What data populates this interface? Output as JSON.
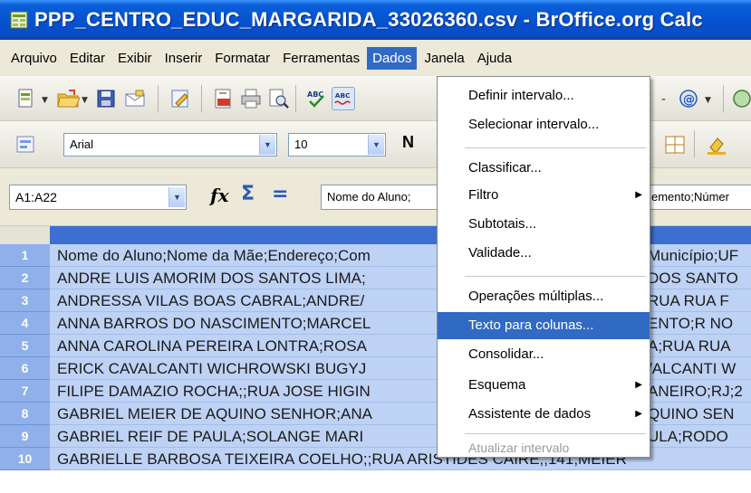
{
  "window": {
    "title": "PPP_CENTRO_EDUC_MARGARIDA_33026360.csv - BrOffice.org Calc"
  },
  "menubar": {
    "items": [
      "Arquivo",
      "Editar",
      "Exibir",
      "Inserir",
      "Formatar",
      "Ferramentas",
      "Dados",
      "Janela",
      "Ajuda"
    ],
    "active": "Dados"
  },
  "toolbar_formatting": {
    "font_name": "Arial",
    "font_size": "10",
    "bold_label": "N"
  },
  "formula_bar": {
    "name_box": "A1:A22",
    "content": "Nome do Aluno;",
    "content_right": "emento;Númer"
  },
  "sheet": {
    "rows": [
      {
        "num": "1",
        "text": "Nome do Aluno;Nome da Mãe;Endereço;Com",
        "right": "Município;UF"
      },
      {
        "num": "2",
        "text": "ANDRE LUIS AMORIM DOS SANTOS LIMA;",
        "right": "DOS SANTO"
      },
      {
        "num": "3",
        "text": "ANDRESSA VILAS BOAS CABRAL;ANDRE/",
        "right": "RUA RUA F"
      },
      {
        "num": "4",
        "text": "ANNA BARROS DO NASCIMENTO;MARCEL",
        "right": "ENTO;R NO"
      },
      {
        "num": "5",
        "text": "ANNA CAROLINA PEREIRA LONTRA;ROSA",
        "right": "A;RUA RUA"
      },
      {
        "num": "6",
        "text": "ERICK CAVALCANTI WICHROWSKI BUGYJ",
        "right": "/ALCANTI W"
      },
      {
        "num": "7",
        "text": "FILIPE DAMAZIO ROCHA;;RUA JOSE HIGIN",
        "right": "ANEIRO;RJ;2"
      },
      {
        "num": "8",
        "text": "GABRIEL MEIER DE AQUINO SENHOR;ANA",
        "right": "QUINO SEN"
      },
      {
        "num": "9",
        "text": "GABRIEL REIF DE PAULA;SOLANGE MARI",
        "right": "ULA;RODO"
      },
      {
        "num": "10",
        "text": "GABRIELLE BARBOSA TEIXEIRA COELHO;;RUA ARISTIDES CAIRE;;141;MEIER",
        "right": ""
      }
    ]
  },
  "dropdown": {
    "items": [
      {
        "label": "Definir intervalo...",
        "submenu": false,
        "disabled": false,
        "highlighted": false
      },
      {
        "label": "Selecionar intervalo...",
        "submenu": false,
        "disabled": false,
        "highlighted": false
      },
      {
        "label": "Classificar...",
        "submenu": false,
        "disabled": false,
        "highlighted": false
      },
      {
        "label": "Filtro",
        "submenu": true,
        "disabled": false,
        "highlighted": false
      },
      {
        "label": "Subtotais...",
        "submenu": false,
        "disabled": false,
        "highlighted": false
      },
      {
        "label": "Validade...",
        "submenu": false,
        "disabled": false,
        "highlighted": false
      },
      {
        "label": "Operações múltiplas...",
        "submenu": false,
        "disabled": false,
        "highlighted": false
      },
      {
        "label": "Texto para colunas...",
        "submenu": false,
        "disabled": false,
        "highlighted": true
      },
      {
        "label": "Consolidar...",
        "submenu": false,
        "disabled": false,
        "highlighted": false
      },
      {
        "label": "Esquema",
        "submenu": true,
        "disabled": false,
        "highlighted": false
      },
      {
        "label": "Assistente de dados",
        "submenu": true,
        "disabled": false,
        "highlighted": false
      },
      {
        "label": "Atualizar intervalo",
        "submenu": false,
        "disabled": true,
        "highlighted": false
      }
    ]
  },
  "colors": {
    "title_bar": "#0553d1",
    "menu_highlight": "#316ac5",
    "selection_cell": "#bed2f5",
    "row_header_selected": "#8fb0ea"
  }
}
